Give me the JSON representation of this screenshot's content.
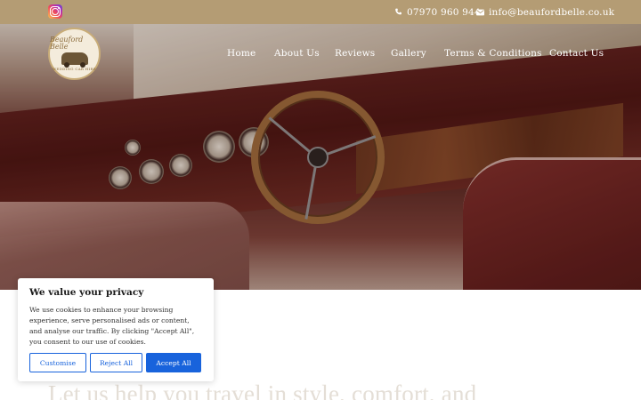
{
  "topbar": {
    "phone": "07970 960 944",
    "email": "info@beaufordbelle.co.uk",
    "icons": [
      "instagram-icon",
      "phone-icon",
      "mail-icon"
    ],
    "background": "#b49c74"
  },
  "logo": {
    "brand": "Beauford Belle",
    "tagline": "WEDDING CAR HIRE"
  },
  "nav": {
    "items": [
      "Home",
      "About Us",
      "Reviews",
      "Gallery",
      "Terms & Conditions",
      "Contact Us"
    ]
  },
  "main": {
    "heading": "Let us help you travel in style, comfort, and"
  },
  "cookie": {
    "title": "We value your privacy",
    "body": "We use cookies to enhance your browsing experience, serve personalised ads or content, and analyse our traffic. By clicking \"Accept All\", you consent to our use of cookies.",
    "customise": "Customise",
    "reject": "Reject All",
    "accept": "Accept All",
    "accent": "#1863dc"
  }
}
